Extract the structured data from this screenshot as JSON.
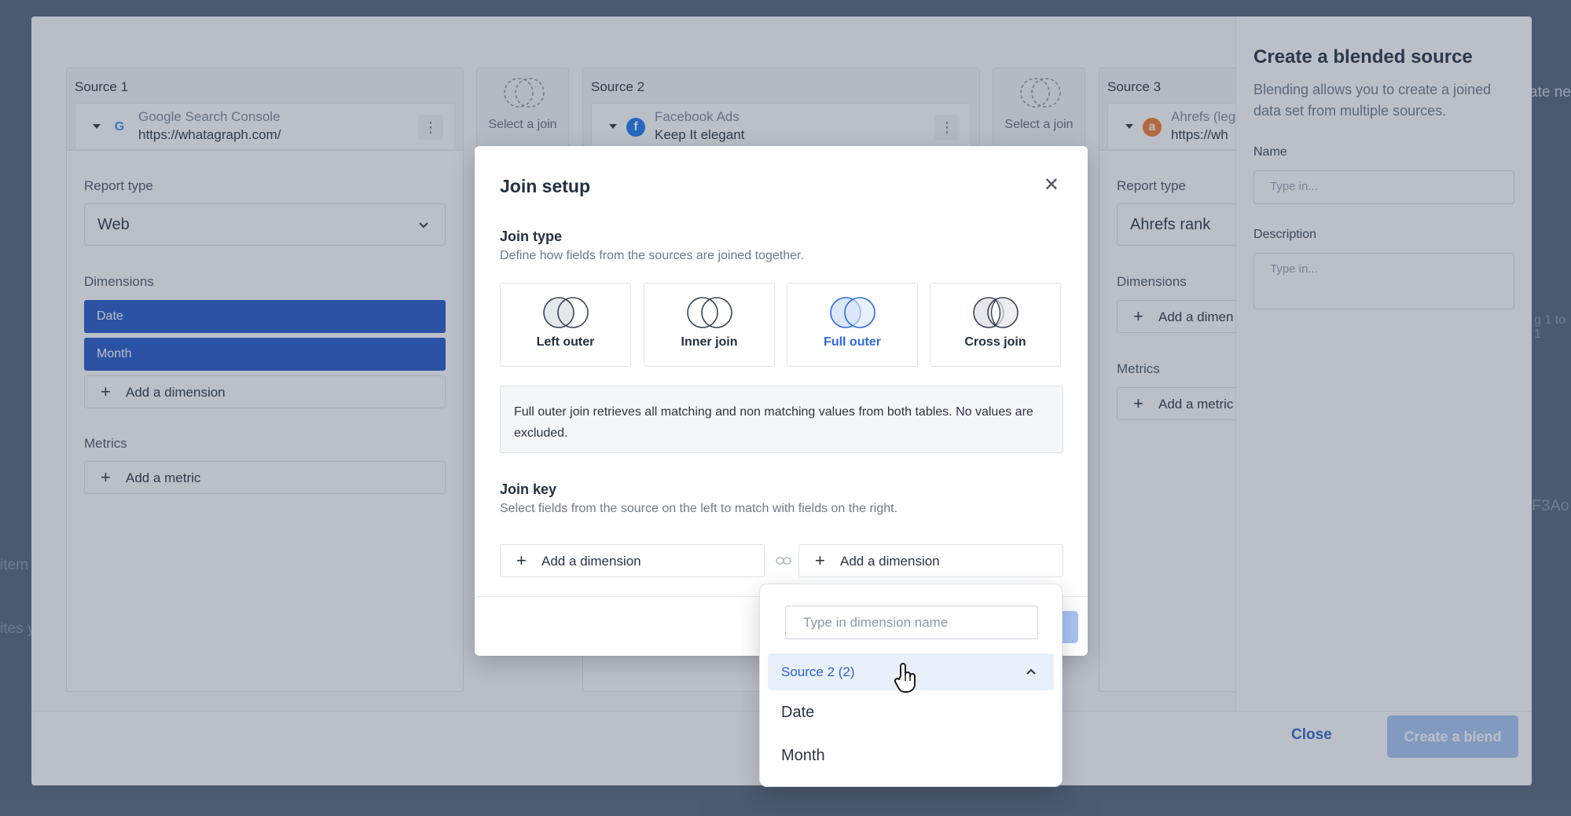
{
  "background_fragments": {
    "right_top": "ate ne",
    "right_mid": "g 1 to 1",
    "right_low": "F3Ao",
    "left_1": "item",
    "left_2": "ites y"
  },
  "sources": [
    {
      "label": "Source 1",
      "name": "Google Search Console",
      "detail": "https://whatagraph.com/",
      "icon": "google-icon",
      "report_type_label": "Report type",
      "report_type": "Web",
      "dimensions_label": "Dimensions",
      "dimensions": [
        "Date",
        "Month"
      ],
      "add_dimension": "Add a dimension",
      "metrics_label": "Metrics",
      "add_metric": "Add a metric"
    },
    {
      "label": "Source 2",
      "name": "Facebook Ads",
      "detail": "Keep It elegant",
      "icon": "facebook-icon"
    },
    {
      "label": "Source 3",
      "name": "Ahrefs (leg",
      "detail": "https://wh",
      "icon": "ahrefs-icon",
      "report_type_label": "Report type",
      "report_type": "Ahrefs rank",
      "dimensions_label": "Dimensions",
      "add_dimension": "Add a dimen",
      "metrics_label": "Metrics",
      "add_metric": "Add a metric"
    }
  ],
  "join_slots": [
    "Select a join",
    "Select a join"
  ],
  "side_panel": {
    "title": "Create a blended source",
    "description": "Blending allows you to create a joined data set from multiple sources.",
    "name_label": "Name",
    "name_placeholder": "Type in...",
    "description_label": "Description",
    "description_placeholder": "Type in..."
  },
  "footer": {
    "close": "Close",
    "create": "Create a blend"
  },
  "modal": {
    "title": "Join setup",
    "join_type_title": "Join type",
    "join_type_sub": "Define how fields from the sources are joined together.",
    "join_types": [
      {
        "label": "Left outer",
        "icon": "left-outer-icon",
        "selected": false
      },
      {
        "label": "Inner join",
        "icon": "inner-join-icon",
        "selected": false
      },
      {
        "label": "Full outer",
        "icon": "full-outer-icon",
        "selected": true
      },
      {
        "label": "Cross join",
        "icon": "cross-join-icon",
        "selected": false
      }
    ],
    "info": "Full outer join retrieves all matching and non matching values from both tables. No values are excluded.",
    "join_key_title": "Join key",
    "join_key_sub": "Select fields from the source on the left to match with fields on the right.",
    "left_key": "Add a dimension",
    "right_key": "Add a dimension"
  },
  "dropdown": {
    "placeholder": "Type in dimension name",
    "group": "Source 2 (2)",
    "items": [
      "Date",
      "Month"
    ]
  },
  "colors": {
    "accent": "#2357c8",
    "selected_join": "#2f6bdc",
    "overlay": "#546379"
  }
}
